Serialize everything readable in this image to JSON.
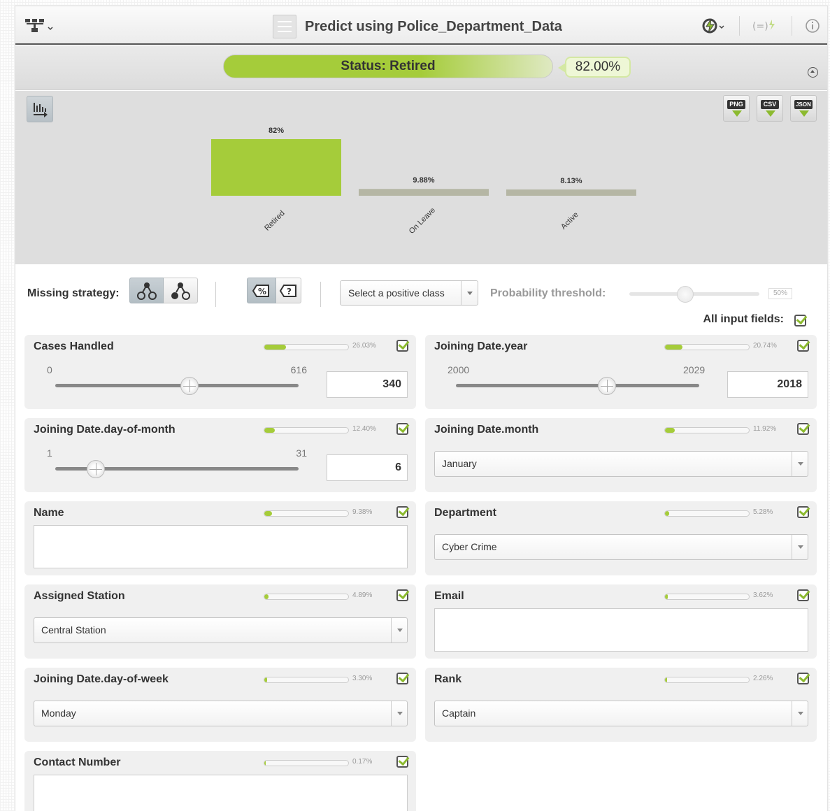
{
  "header": {
    "title": "Predict using Police_Department_Data",
    "left_icon": "model-tree-icon",
    "right_icons": [
      "prediction-lightning-icon",
      "formula-lightning-icon",
      "info-icon"
    ]
  },
  "status": {
    "label": "Status: Retired",
    "confidence": "82.00%",
    "confidence_fraction": 0.82
  },
  "chart": {
    "download_buttons": [
      "PNG",
      "CSV",
      "JSON"
    ]
  },
  "chart_data": {
    "type": "bar",
    "categories": [
      "Retired",
      "On Leave",
      "Active"
    ],
    "values": [
      82,
      9.88,
      8.13
    ],
    "value_labels": [
      "82%",
      "9.88%",
      "8.13%"
    ],
    "colors": [
      "#a5cc3a",
      "#b5b6a4",
      "#b5b6a4"
    ],
    "ylim": [
      0,
      100
    ]
  },
  "controls": {
    "missing_strategy_label": "Missing strategy:",
    "positive_class_placeholder": "Select a positive class",
    "probability_threshold_label": "Probability threshold:",
    "probability_threshold_value": "50%",
    "probability_threshold_fraction": 0.5,
    "all_input_fields_label": "All input fields:"
  },
  "fields": [
    {
      "label": "Cases Handled",
      "importance": "26.03%",
      "importance_fraction": 0.2603,
      "type": "range",
      "min": "0",
      "max": "616",
      "value": "340",
      "slider_fraction": 0.552
    },
    {
      "label": "Joining Date.year",
      "importance": "20.74%",
      "importance_fraction": 0.2074,
      "type": "range",
      "min": "2000",
      "max": "2029",
      "value": "2018",
      "slider_fraction": 0.621
    },
    {
      "label": "Joining Date.day-of-month",
      "importance": "12.40%",
      "importance_fraction": 0.124,
      "type": "range",
      "min": "1",
      "max": "31",
      "value": "6",
      "slider_fraction": 0.167
    },
    {
      "label": "Joining Date.month",
      "importance": "11.92%",
      "importance_fraction": 0.1192,
      "type": "select",
      "value": "January"
    },
    {
      "label": "Name",
      "importance": "9.38%",
      "importance_fraction": 0.0938,
      "type": "text",
      "value": ""
    },
    {
      "label": "Department",
      "importance": "5.28%",
      "importance_fraction": 0.0528,
      "type": "select",
      "value": "Cyber Crime"
    },
    {
      "label": "Assigned Station",
      "importance": "4.89%",
      "importance_fraction": 0.0489,
      "type": "select",
      "value": "Central Station"
    },
    {
      "label": "Email",
      "importance": "3.62%",
      "importance_fraction": 0.0362,
      "type": "text",
      "value": ""
    },
    {
      "label": "Joining Date.day-of-week",
      "importance": "3.30%",
      "importance_fraction": 0.033,
      "type": "select",
      "value": "Monday"
    },
    {
      "label": "Rank",
      "importance": "2.26%",
      "importance_fraction": 0.0226,
      "type": "select",
      "value": "Captain"
    },
    {
      "label": "Contact Number",
      "importance": "0.17%",
      "importance_fraction": 0.0017,
      "type": "text",
      "value": ""
    }
  ]
}
